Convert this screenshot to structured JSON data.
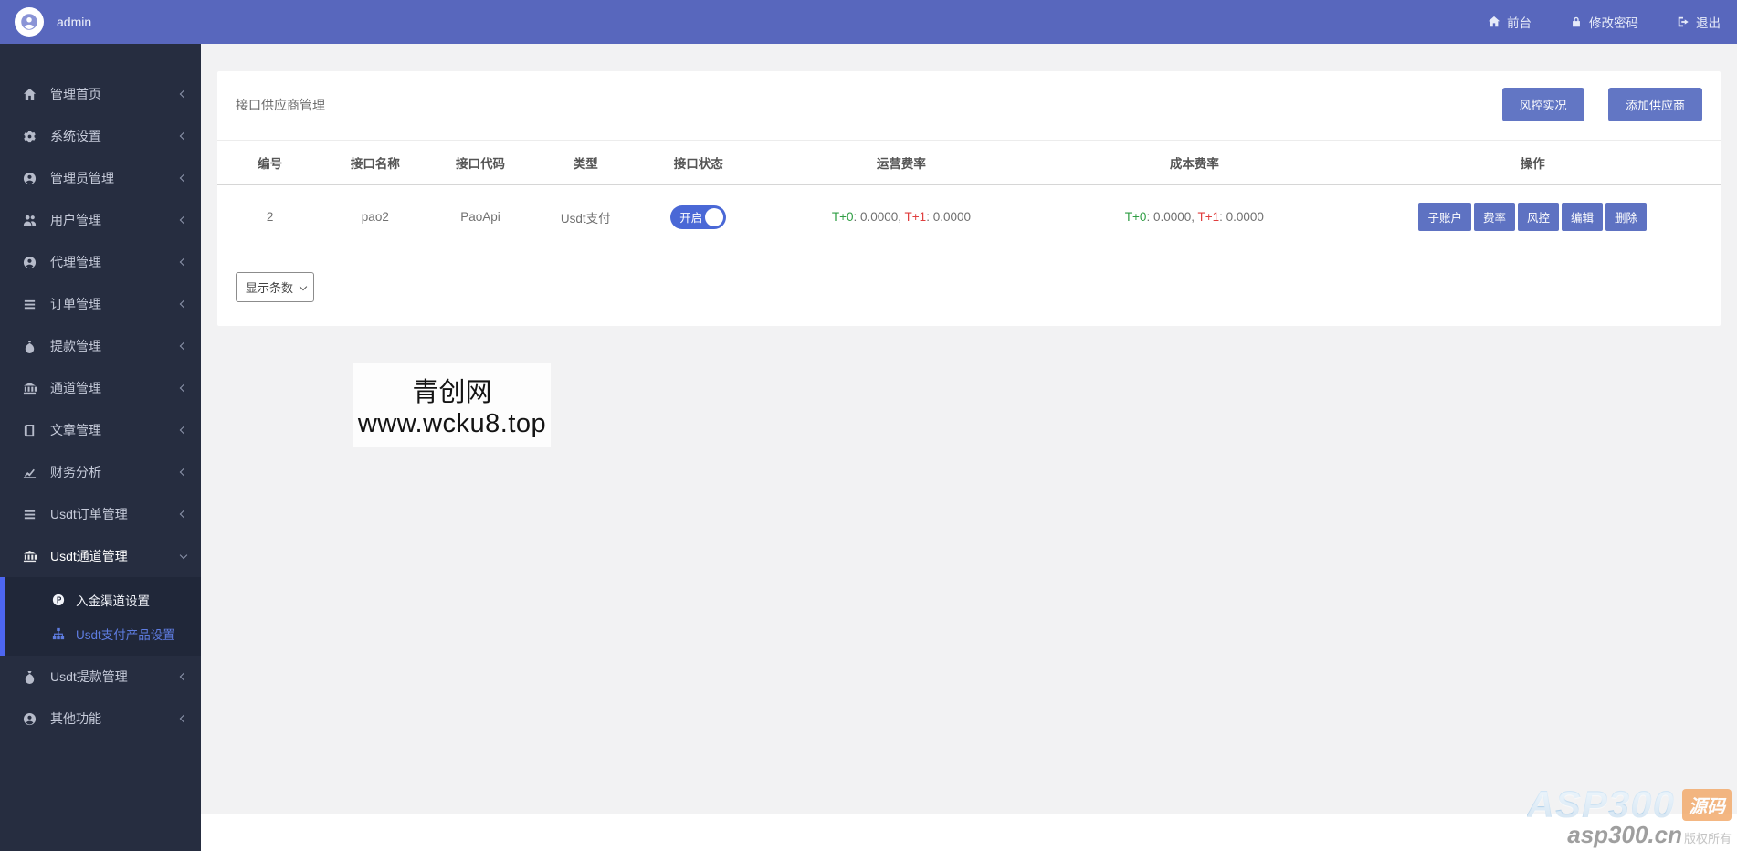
{
  "topbar": {
    "username": "admin",
    "nav": [
      {
        "label": "前台"
      },
      {
        "label": "修改密码"
      },
      {
        "label": "退出"
      }
    ]
  },
  "sidebar": {
    "items": [
      {
        "label": "管理首页",
        "icon": "home-icon"
      },
      {
        "label": "系统设置",
        "icon": "gears-icon"
      },
      {
        "label": "管理员管理",
        "icon": "user-circle-icon"
      },
      {
        "label": "用户管理",
        "icon": "users-icon"
      },
      {
        "label": "代理管理",
        "icon": "user-circle-icon"
      },
      {
        "label": "订单管理",
        "icon": "list-icon"
      },
      {
        "label": "提款管理",
        "icon": "money-bag-icon"
      },
      {
        "label": "通道管理",
        "icon": "bank-icon"
      },
      {
        "label": "文章管理",
        "icon": "book-icon"
      },
      {
        "label": "财务分析",
        "icon": "chart-line-icon"
      },
      {
        "label": "Usdt订单管理",
        "icon": "list-icon"
      },
      {
        "label": "Usdt通道管理",
        "icon": "bank-icon",
        "expanded": true,
        "children": [
          {
            "label": "入金渠道设置",
            "icon": "p-circle-icon",
            "active": false
          },
          {
            "label": "Usdt支付产品设置",
            "icon": "sitemap-icon",
            "active": true
          }
        ]
      },
      {
        "label": "Usdt提款管理",
        "icon": "money-bag-icon"
      },
      {
        "label": "其他功能",
        "icon": "user-circle-icon"
      }
    ]
  },
  "main": {
    "page_title": "接口供应商管理",
    "buttons": {
      "risk_live": "风控实况",
      "add_supplier": "添加供应商"
    },
    "table": {
      "headers": [
        "编号",
        "接口名称",
        "接口代码",
        "类型",
        "接口状态",
        "运营费率",
        "成本费率",
        "操作"
      ],
      "rows": [
        {
          "id": "2",
          "name": "pao2",
          "code": "PaoApi",
          "type": "Usdt支付",
          "status": "开启",
          "op_rate": {
            "t0": "T+0",
            "t0v": ": 0.0000,",
            "t1": "T+1",
            "t1v": ": 0.0000"
          },
          "cost_rate": {
            "t0": "T+0",
            "t0v": ": 0.0000,",
            "t1": "T+1",
            "t1v": ": 0.0000"
          },
          "actions": [
            "子账户",
            "费率",
            "风控",
            "编辑",
            "删除"
          ]
        }
      ]
    },
    "page_size_label": "显示条数",
    "watermark": {
      "line1": "青创网",
      "line2": "www.wcku8.top"
    }
  },
  "footer": {
    "logo": "ASP300",
    "badge": "源码",
    "domain": "asp300.cn",
    "copyright": "版权所有"
  },
  "colors": {
    "topbar": "#5867bd",
    "sidebar": "#262d40",
    "submenu_bar": "#4d66f0",
    "accent_button": "#6276c4",
    "toggle_on": "#4a68d6",
    "rate_green": "#2f9e44",
    "rate_red": "#e03e3e",
    "content_bg": "#f2f2f3"
  }
}
